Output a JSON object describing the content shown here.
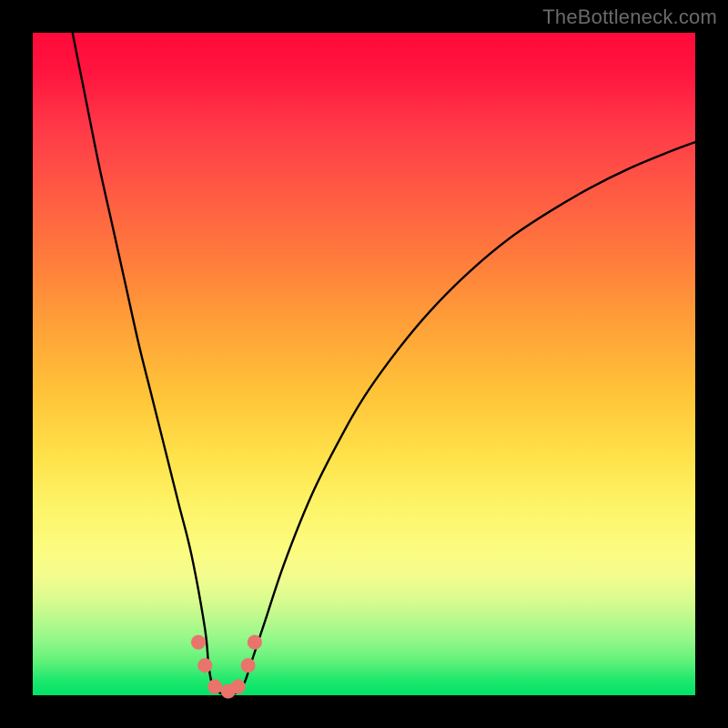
{
  "watermark": "TheBottleneck.com",
  "colors": {
    "frame": "#000000",
    "curve": "#000000",
    "marker_fill": "#e9746c",
    "marker_stroke": "#d45c56",
    "gradient_top": "#ff0a3a",
    "gradient_bottom": "#00e268"
  },
  "chart_data": {
    "type": "line",
    "title": "",
    "xlabel": "",
    "ylabel": "",
    "xlim": [
      0,
      100
    ],
    "ylim": [
      0,
      100
    ],
    "grid": false,
    "legend": false,
    "annotations": [],
    "series": [
      {
        "name": "bottleneck-curve",
        "x": [
          6,
          8,
          10,
          12,
          14,
          16,
          18,
          20,
          22,
          24,
          26,
          26.5,
          27,
          28,
          29,
          30,
          31,
          32,
          33,
          35,
          38,
          42,
          46,
          50,
          55,
          60,
          66,
          72,
          78,
          84,
          90,
          96,
          100
        ],
        "y": [
          100,
          90,
          80,
          71,
          62,
          53,
          45,
          37,
          29,
          21,
          10,
          5,
          2,
          0.5,
          0.2,
          0.2,
          0.5,
          2,
          5,
          11,
          20,
          30,
          38,
          45,
          52,
          58,
          64,
          69,
          73,
          76.5,
          79.5,
          82,
          83.5
        ]
      }
    ],
    "markers": [
      {
        "x": 25.0,
        "y": 8.0
      },
      {
        "x": 26.0,
        "y": 4.5
      },
      {
        "x": 27.5,
        "y": 1.3
      },
      {
        "x": 29.5,
        "y": 0.6
      },
      {
        "x": 31.0,
        "y": 1.3
      },
      {
        "x": 32.5,
        "y": 4.5
      },
      {
        "x": 33.5,
        "y": 8.0
      }
    ]
  }
}
